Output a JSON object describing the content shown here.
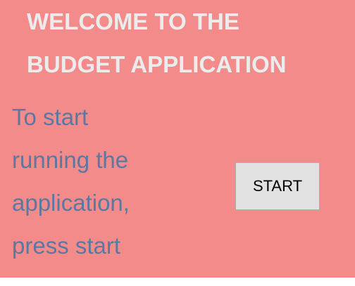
{
  "header": {
    "title_line1": "WELCOME TO THE",
    "title_line2": "BUDGET APPLICATION"
  },
  "main": {
    "instructions": [
      "To start",
      "running the",
      "application,",
      "press start"
    ],
    "start_button_label": "START"
  },
  "colors": {
    "background": "#f38b8b",
    "title_text": "#ececec",
    "instruction_text": "#5b78a2",
    "button_bg": "#e1e1e1"
  }
}
